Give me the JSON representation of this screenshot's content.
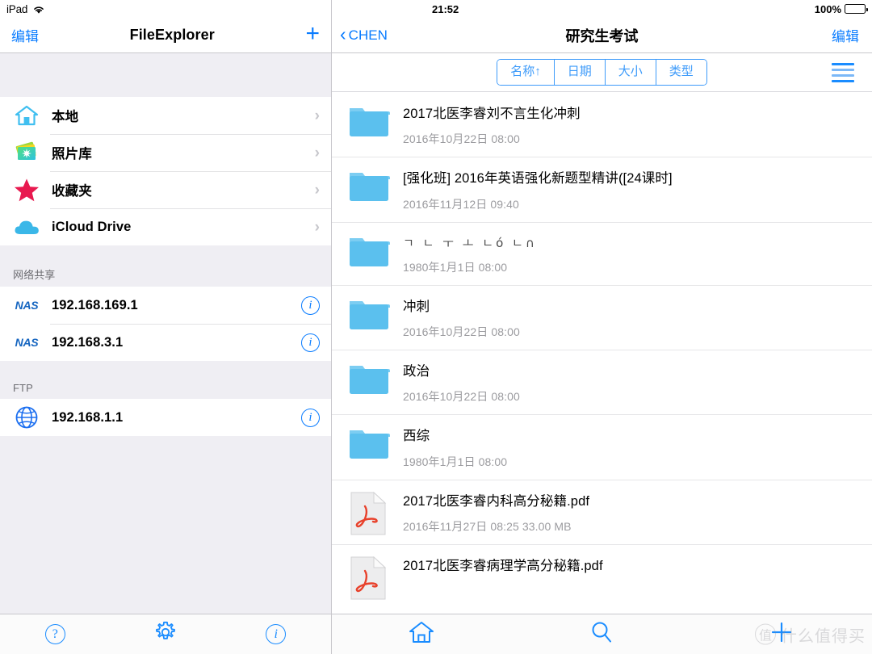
{
  "left": {
    "status": {
      "device": "iPad",
      "wifi_icon": "wifi-icon"
    },
    "navbar": {
      "edit_label": "编辑",
      "title": "FileExplorer",
      "add_label": "+"
    },
    "sections": [
      {
        "header": "",
        "items": [
          {
            "icon": "home-icon",
            "label": "本地",
            "accessory": "chevron"
          },
          {
            "icon": "photo-library-icon",
            "label": "照片库",
            "accessory": "chevron"
          },
          {
            "icon": "star-icon",
            "label": "收藏夹",
            "accessory": "chevron"
          },
          {
            "icon": "cloud-icon",
            "label": "iCloud Drive",
            "accessory": "chevron"
          }
        ]
      },
      {
        "header": "网络共享",
        "items": [
          {
            "icon": "nas-icon",
            "label": "192.168.169.1",
            "accessory": "info"
          },
          {
            "icon": "nas-icon",
            "label": "192.168.3.1",
            "accessory": "info"
          }
        ]
      },
      {
        "header": "FTP",
        "items": [
          {
            "icon": "globe-icon",
            "label": "192.168.1.1",
            "accessory": "info"
          }
        ]
      }
    ],
    "tabbar": [
      {
        "icon": "help-icon",
        "glyph": "?"
      },
      {
        "icon": "gear-icon",
        "glyph": ""
      },
      {
        "icon": "info-icon",
        "glyph": "i"
      }
    ]
  },
  "right": {
    "status": {
      "time": "21:52",
      "battery_percent": "100%"
    },
    "navbar": {
      "back_label": "CHEN",
      "title": "研究生考试",
      "edit_label": "编辑"
    },
    "sortbar": {
      "segments": [
        {
          "label": "名称↑",
          "selected": true
        },
        {
          "label": "日期",
          "selected": false
        },
        {
          "label": "大小",
          "selected": false
        },
        {
          "label": "类型",
          "selected": false
        }
      ],
      "menu_icon": "hamburger-menu-icon"
    },
    "files": [
      {
        "type": "folder",
        "name": "2017北医李睿刘不言生化冲刺",
        "meta": "2016年10月22日 08:00",
        "mojibake": false
      },
      {
        "type": "folder",
        "name": "[强化班] 2016年英语强化新题型精讲([24课时]",
        "meta": "2016年11月12日 09:40",
        "mojibake": false
      },
      {
        "type": "folder",
        "name": "ㄱ ㄴ ㅜ ㅗ ㄴó ㄴ∩",
        "meta": "1980年1月1日 08:00",
        "mojibake": true
      },
      {
        "type": "folder",
        "name": "冲刺",
        "meta": "2016年10月22日 08:00",
        "mojibake": false
      },
      {
        "type": "folder",
        "name": "政治",
        "meta": "2016年10月22日 08:00",
        "mojibake": false
      },
      {
        "type": "folder",
        "name": "西综",
        "meta": "1980年1月1日 08:00",
        "mojibake": false
      },
      {
        "type": "pdf",
        "name": "2017北医李睿内科高分秘籍.pdf",
        "meta": "2016年11月27日 08:25  33.00 MB",
        "mojibake": false
      },
      {
        "type": "pdf",
        "name": "2017北医李睿病理学高分秘籍.pdf",
        "meta": "",
        "mojibake": false
      }
    ],
    "tabbar": [
      {
        "icon": "home-icon"
      },
      {
        "icon": "search-icon"
      },
      {
        "icon": "add-icon"
      }
    ],
    "watermark": {
      "badge": "值",
      "text": "什么值得买"
    }
  },
  "colors": {
    "accent_blue": "#0a7cff",
    "segment_blue": "#3e9bfa",
    "folder_blue": "#5bc0ee",
    "pdf_red": "#e8412b",
    "star_red": "#e8194f",
    "nas_blue": "#1565c0",
    "group_bg": "#efeef3"
  }
}
